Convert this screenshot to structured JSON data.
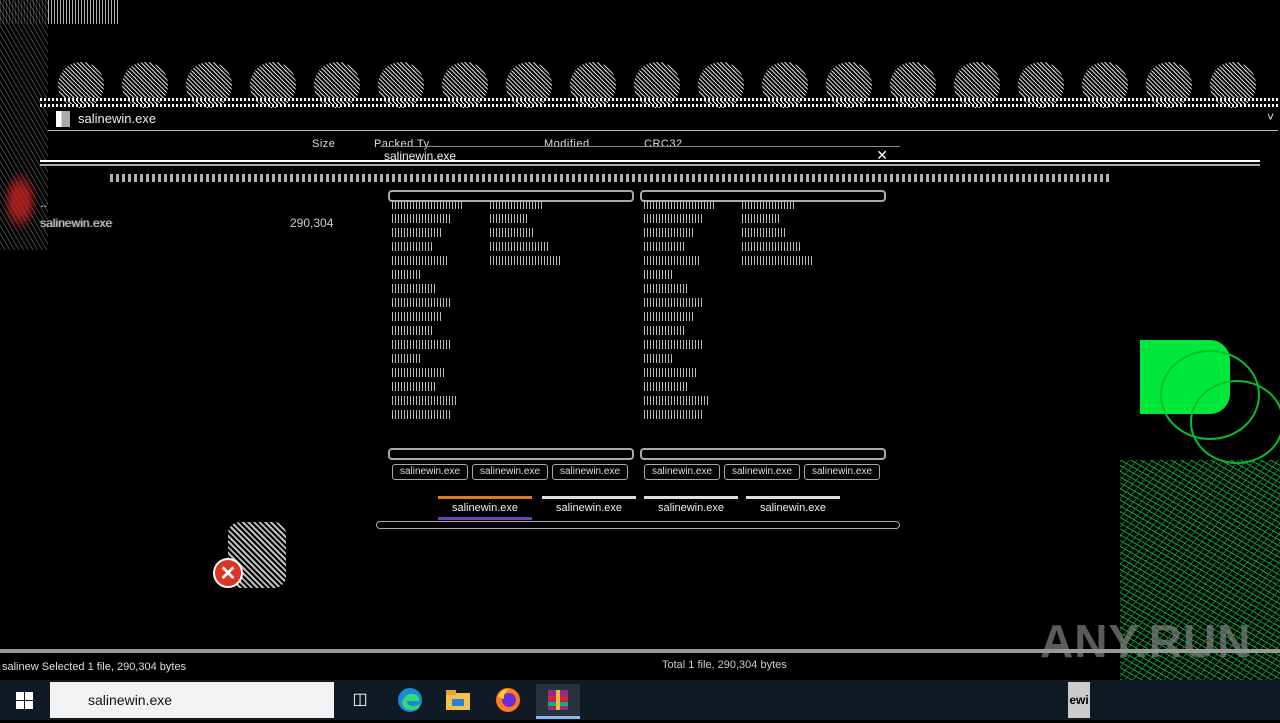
{
  "window": {
    "title": "salinewin.exe",
    "chevron": "˅",
    "columns": {
      "size": "Size",
      "packed": "Packed Ty...",
      "modified": "Modified",
      "crc": "CRC32"
    },
    "files": [
      {
        "name": "..",
        "size": ""
      },
      {
        "name": "salinewin.exe",
        "size": "290,304"
      }
    ]
  },
  "dialog": {
    "title": "salinewin.exe",
    "close": "✕",
    "tabs": [
      {
        "label": "salinewin.exe"
      },
      {
        "label": "salinewin.exe"
      },
      {
        "label": "salinewin.exe"
      },
      {
        "label": "salinewin.exe"
      }
    ],
    "button_rows": [
      {
        "label": "salinewin.exe"
      },
      {
        "label": "salinewin.exe"
      },
      {
        "label": "salinewin.exe"
      },
      {
        "label": "salinewin.exe"
      },
      {
        "label": "salinewin.exe"
      },
      {
        "label": "salinewin.exe"
      }
    ]
  },
  "error_icon": {
    "glyph": "✕"
  },
  "watermark": {
    "text": "ANY.RUN"
  },
  "statusbar": {
    "left": "salinew Selected 1 file, 290,304 bytes",
    "right": "Total 1 file, 290,304 bytes"
  },
  "taskbar": {
    "search_value": "salinewin.exe",
    "icons": [
      "windows-start-icon",
      "task-view-icon",
      "edge-icon",
      "file-explorer-icon",
      "firefox-icon",
      "winrar-icon"
    ],
    "right_fragment": "ewi"
  }
}
